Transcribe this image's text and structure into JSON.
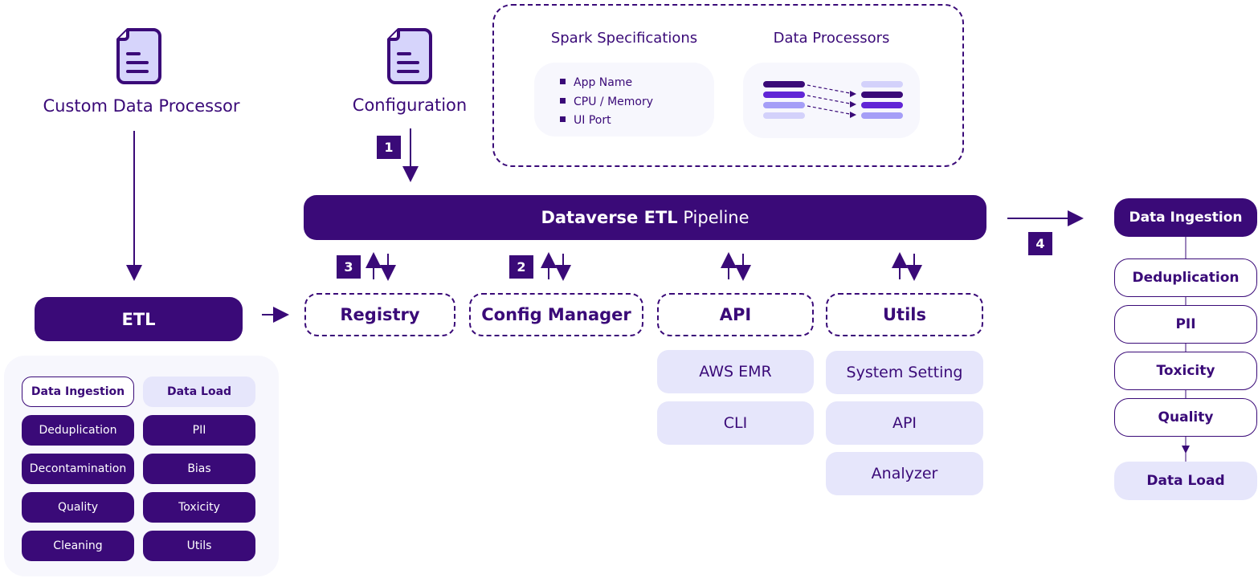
{
  "colors": {
    "primary": "#3a0a78",
    "light": "#e6e6fb",
    "panel": "#f7f7fd",
    "mid": "#6125d6",
    "soft": "#a59ef7"
  },
  "inputs": {
    "custom": {
      "icon": "document-icon",
      "label": "Custom Data Processor"
    },
    "config": {
      "icon": "document-icon",
      "label": "Configuration"
    }
  },
  "spec_box": {
    "spark_title": "Spark Specifications",
    "spark_items": [
      "App Name",
      "CPU / Memory",
      "UI Port"
    ],
    "processors_title": "Data Processors"
  },
  "pipeline": {
    "bold": "Dataverse ETL",
    "rest": " Pipeline"
  },
  "steps": [
    "1",
    "2",
    "3",
    "4"
  ],
  "etl": {
    "label": "ETL",
    "grid": [
      [
        "Data Ingestion",
        "Data Load"
      ],
      [
        "Deduplication",
        "PII"
      ],
      [
        "Decontamination",
        "Bias"
      ],
      [
        "Quality",
        "Toxicity"
      ],
      [
        "Cleaning",
        "Utils"
      ]
    ]
  },
  "modules": {
    "registry": "Registry",
    "config_manager": "Config Manager",
    "api": "API",
    "utils": "Utils"
  },
  "api_items": [
    "AWS EMR",
    "CLI"
  ],
  "utils_items": [
    "System Setting",
    "API",
    "Analyzer"
  ],
  "flow": [
    "Data Ingestion",
    "Deduplication",
    "PII",
    "Toxicity",
    "Quality",
    "Data Load"
  ]
}
